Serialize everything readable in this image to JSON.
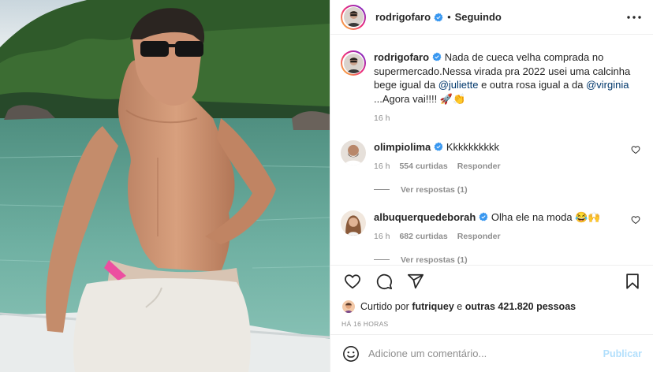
{
  "post": {
    "author": "rodrigofaro",
    "follow_status": "Seguindo",
    "dot": "•",
    "caption": {
      "username": "rodrigofaro",
      "text_1": "Nada de cueca velha comprada no supermercado.Nessa virada pra 2022 usei uma calcinha bege igual da ",
      "mention_1": "@juliette",
      "text_2": " e outra rosa igual a da ",
      "mention_2": "@virginia",
      "text_3": " ...Agora vai!!!! 🚀👏",
      "time": "16 h"
    },
    "comments": [
      {
        "username": "olimpiolima",
        "text": "Kkkkkkkkkk",
        "time": "16 h",
        "likes": "554 curtidas",
        "reply": "Responder",
        "view_replies": "Ver respostas (1)"
      },
      {
        "username": "albuquerquedeborah",
        "text": "Olha ele na moda 😂🙌",
        "time": "16 h",
        "likes": "682 curtidas",
        "reply": "Responder",
        "view_replies": "Ver respostas (1)"
      }
    ],
    "liked_by": {
      "prefix": "Curtido por",
      "user": "futriquey",
      "middle": "e",
      "others": "outras 421.820 pessoas"
    },
    "time_ago": "HÁ 16 HORAS",
    "add_comment": {
      "placeholder": "Adicione um comentário...",
      "post_label": "Publicar"
    }
  },
  "icons": {
    "more": "more-horizontal-icon",
    "like": "heart-icon",
    "comment": "comment-icon",
    "share": "share-icon",
    "save": "bookmark-icon",
    "emoji": "emoji-icon",
    "verified": "verified-badge-icon"
  },
  "colors": {
    "link": "#00376b",
    "muted": "#8e8e8e",
    "verified": "#3897f0",
    "post_disabled": "#b2dffc"
  }
}
